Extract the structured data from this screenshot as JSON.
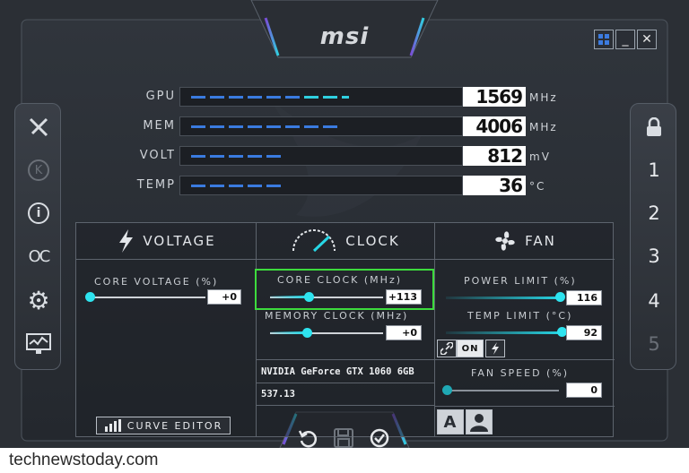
{
  "app": {
    "brand": "msi",
    "window_controls": {
      "windows_icon": "windows-logo-icon",
      "minimize": "_",
      "close": "✕"
    }
  },
  "left_rail": [
    {
      "id": "kombustor",
      "icon": "kombustor-flame-icon"
    },
    {
      "id": "k-boost",
      "icon": "k-circle-icon",
      "label": "K"
    },
    {
      "id": "info",
      "icon": "info-icon",
      "label": "i"
    },
    {
      "id": "oc-scanner",
      "icon": "oc-scanner-icon",
      "label": "OC"
    },
    {
      "id": "settings",
      "icon": "gear-icon"
    },
    {
      "id": "monitor",
      "icon": "monitor-chart-icon"
    }
  ],
  "right_rail": {
    "lock_icon": "lock-icon",
    "profiles": [
      "1",
      "2",
      "3",
      "4",
      "5"
    ]
  },
  "monitors": [
    {
      "label": "GPU",
      "value": "1569",
      "unit": "MHz",
      "fill": 0.62,
      "color": "#3a7be0"
    },
    {
      "label": "MEM",
      "value": "4006",
      "unit": "MHz",
      "fill": 0.55,
      "color": "#3a7be0"
    },
    {
      "label": "VOLT",
      "value": "812",
      "unit": "mV",
      "fill": 0.4,
      "color": "#3a7be0"
    },
    {
      "label": "TEMP",
      "value": "36",
      "unit": "°C",
      "fill": 0.36,
      "color": "#3a7be0"
    }
  ],
  "sections": {
    "voltage": {
      "title": "VOLTAGE",
      "icon": "lightning-icon"
    },
    "clock": {
      "title": "CLOCK",
      "icon": "speedometer-icon"
    },
    "fan": {
      "title": "FAN",
      "icon": "fan-icon"
    }
  },
  "controls": {
    "core_voltage": {
      "label": "CORE VOLTAGE  (%)",
      "value": "+0",
      "level": 0.0
    },
    "core_clock": {
      "label": "CORE CLOCK (MHz)",
      "value": "+113",
      "level": 0.26
    },
    "memory_clock": {
      "label": "MEMORY CLOCK (MHz)",
      "value": "+0",
      "level": 0.3
    },
    "power_limit": {
      "label": "POWER LIMIT (%)",
      "value": "116",
      "level": 0.97
    },
    "temp_limit": {
      "label": "TEMP LIMIT (°C)",
      "value": "92",
      "level": 0.97
    },
    "fan_speed": {
      "label": "FAN SPEED (%)",
      "value": "0",
      "level": 0.0
    }
  },
  "gpu": {
    "name": "NVIDIA GeForce GTX 1060 6GB",
    "driver": "537.13"
  },
  "link_toggle": {
    "link_icon": "link-icon",
    "state": "ON",
    "sync_icon": "lightning-icon"
  },
  "curve_editor": {
    "label": "CURVE EDITOR",
    "icon": "bar-chart-icon"
  },
  "fan_mode": {
    "auto_label": "A",
    "user_icon": "user-icon"
  },
  "bottom_actions": [
    {
      "id": "reset",
      "icon": "reset-icon"
    },
    {
      "id": "save",
      "icon": "save-icon"
    },
    {
      "id": "apply",
      "icon": "apply-check-icon"
    }
  ],
  "highlight_color": "#3ddc3d",
  "accent_color": "#27d7e6",
  "watermark": "technewstoday.com"
}
